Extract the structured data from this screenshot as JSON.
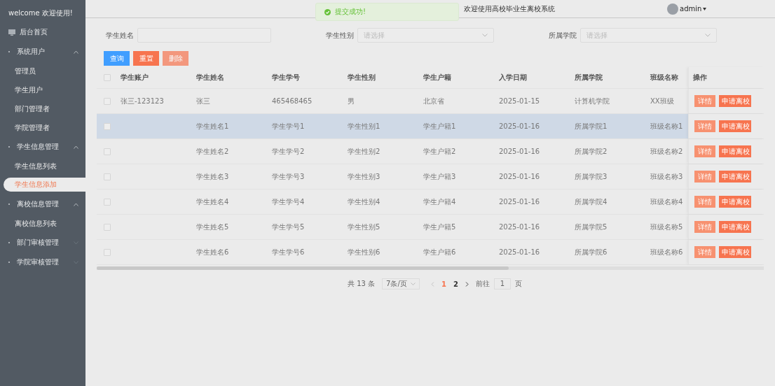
{
  "sidebar": {
    "welcome": "welcome 欢迎使用!",
    "items": [
      {
        "kind": "link",
        "label": "后台首页",
        "selected": false
      },
      {
        "kind": "group",
        "label": "系统用户",
        "expanded": true,
        "children": [
          {
            "label": "管理员",
            "selected": false
          },
          {
            "label": "学生用户",
            "selected": false
          },
          {
            "label": "部门管理者",
            "selected": false
          },
          {
            "label": "学院管理者",
            "selected": false
          }
        ]
      },
      {
        "kind": "group",
        "label": "学生信息管理",
        "expanded": true,
        "children": [
          {
            "label": "学生信息列表",
            "selected": false
          },
          {
            "label": "学生信息添加",
            "selected": true
          }
        ]
      },
      {
        "kind": "group",
        "label": "离校信息管理",
        "expanded": true,
        "children": [
          {
            "label": "离校信息列表",
            "selected": false
          }
        ]
      },
      {
        "kind": "group",
        "label": "部门审核管理",
        "expanded": false
      },
      {
        "kind": "group",
        "label": "学院审核管理",
        "expanded": false
      }
    ]
  },
  "header": {
    "title": "欢迎使用高校毕业生离校系统",
    "user": "admin"
  },
  "toast": {
    "message": "提交成功!"
  },
  "filters": [
    {
      "kind": "input",
      "label": "学生姓名"
    },
    {
      "kind": "select",
      "label": "学生性别",
      "placeholder": "请选择"
    },
    {
      "kind": "select",
      "label": "所属学院",
      "placeholder": "请选择"
    }
  ],
  "buttons": [
    {
      "kind": "primary",
      "label": "查询",
      "disabled": false
    },
    {
      "kind": "warning",
      "label": "重置",
      "disabled": false
    },
    {
      "kind": "danger",
      "label": "删除",
      "disabled": true
    }
  ],
  "table": {
    "columns": [
      "学生账户",
      "学生姓名",
      "学生学号",
      "学生性别",
      "学生户籍",
      "入学日期",
      "所属学院",
      "班级名称",
      "操作"
    ],
    "header_checked": false,
    "rows": [
      {
        "checked": false,
        "selected": false,
        "account": "张三-123123",
        "name": "张三",
        "number": "465468465",
        "gender": "男",
        "origin": "北京省",
        "date": "2025-01-15",
        "college": "计算机学院",
        "class": "XX班级",
        "actions": [
          "详情",
          "申请离校"
        ]
      },
      {
        "checked": false,
        "selected": true,
        "name": "学生姓名1",
        "number": "学生学号1",
        "gender": "学生性别1",
        "origin": "学生户籍1",
        "date": "2025-01-16",
        "college": "所属学院1",
        "class": "班级名称1",
        "actions": [
          "详情",
          "申请离校"
        ]
      },
      {
        "checked": false,
        "selected": false,
        "name": "学生姓名2",
        "number": "学生学号2",
        "gender": "学生性别2",
        "origin": "学生户籍2",
        "date": "2025-01-16",
        "college": "所属学院2",
        "class": "班级名称2",
        "actions": [
          "详情",
          "申请离校"
        ]
      },
      {
        "checked": false,
        "selected": false,
        "name": "学生姓名3",
        "number": "学生学号3",
        "gender": "学生性别3",
        "origin": "学生户籍3",
        "date": "2025-01-16",
        "college": "所属学院3",
        "class": "班级名称3",
        "actions": [
          "详情",
          "申请离校"
        ]
      },
      {
        "checked": false,
        "selected": false,
        "name": "学生姓名4",
        "number": "学生学号4",
        "gender": "学生性别4",
        "origin": "学生户籍4",
        "date": "2025-01-16",
        "college": "所属学院4",
        "class": "班级名称4",
        "actions": [
          "详情",
          "申请离校"
        ]
      },
      {
        "checked": false,
        "selected": false,
        "name": "学生姓名5",
        "number": "学生学号5",
        "gender": "学生性别5",
        "origin": "学生户籍5",
        "date": "2025-01-16",
        "college": "所属学院5",
        "class": "班级名称5",
        "actions": [
          "详情",
          "申请离校"
        ]
      },
      {
        "checked": false,
        "selected": false,
        "name": "学生姓名6",
        "number": "学生学号6",
        "gender": "学生性别6",
        "origin": "学生户籍6",
        "date": "2025-01-16",
        "college": "所属学院6",
        "class": "班级名称6",
        "actions": [
          "详情",
          "申请离校"
        ]
      }
    ]
  },
  "pagination": {
    "total": "共 13 条",
    "page_size": "7条/页",
    "pages": [
      {
        "label": "1",
        "selected": true
      },
      {
        "label": "2",
        "selected": false
      }
    ],
    "goto_label": "前往",
    "goto_value": "1",
    "page_suffix": "页"
  }
}
